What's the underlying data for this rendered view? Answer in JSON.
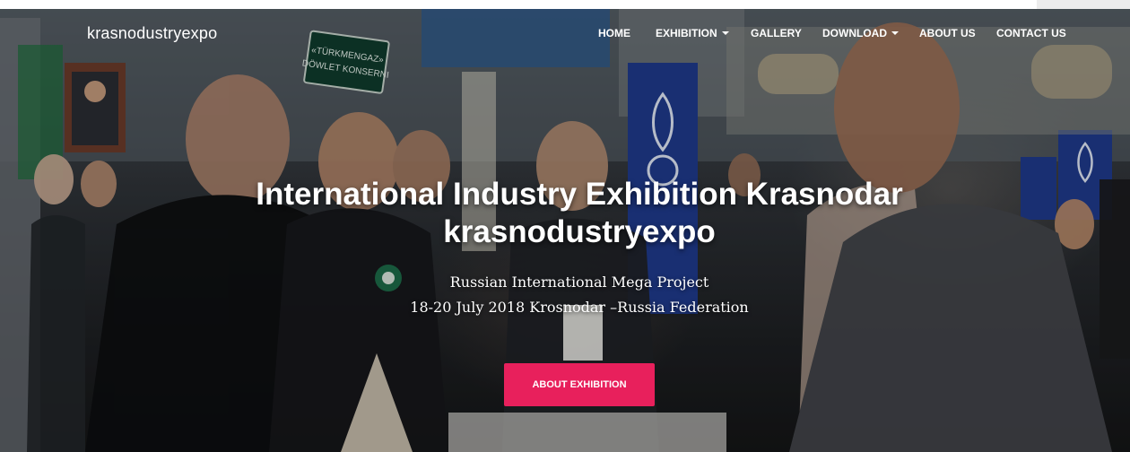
{
  "brand": {
    "name": "krasnodustryexpo"
  },
  "nav": {
    "items": [
      {
        "label": "HOME",
        "dropdown": false
      },
      {
        "label": "EXHIBITION",
        "dropdown": true
      },
      {
        "label": "GALLERY",
        "dropdown": false
      },
      {
        "label": "DOWNLOAD",
        "dropdown": true
      },
      {
        "label": "ABOUT US",
        "dropdown": false
      },
      {
        "label": "CONTACT US",
        "dropdown": false
      }
    ]
  },
  "hero": {
    "title_line1": "International Industry Exhibition Krasnodar",
    "title_line2": "krasnodustryexpo",
    "subtitle1": "Russian International Mega Project",
    "subtitle2": "18-20 July 2018 Krosnodar –Russia Federation",
    "cta_label": "ABOUT EXHIBITION",
    "background": "exhibition-booth-crowd-photo",
    "sign_text_line1": "«TÜRKMENGAZ»",
    "sign_text_line2": "DÖWLET KONSERNI"
  },
  "colors": {
    "accent": "#e8205c",
    "banner_blue": "#1f3a8c",
    "text": "#ffffff"
  }
}
